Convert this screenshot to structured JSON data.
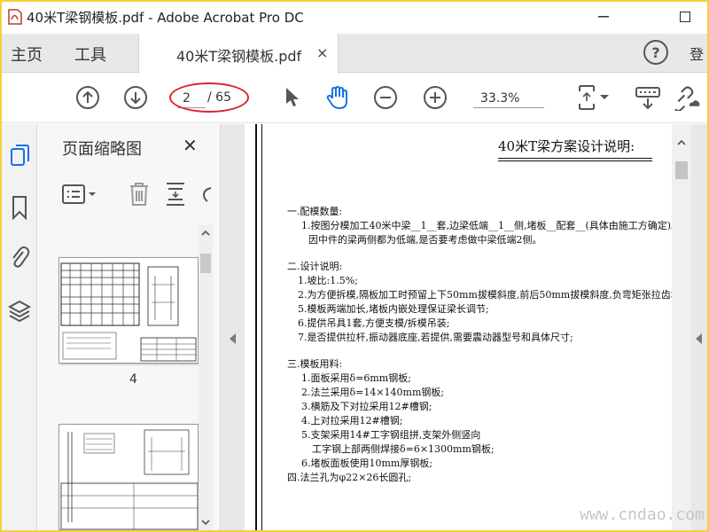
{
  "window": {
    "title": "40米T梁钢模板.pdf - Adobe Acrobat Pro DC"
  },
  "menubar": {
    "home": "主页",
    "tools": "工具",
    "tab_label": "40米T梁钢模板.pdf",
    "tab_close": "×",
    "help": "?",
    "sign_in": "登"
  },
  "toolbar": {
    "current_page": "2",
    "total_pages": "/ 65",
    "zoom": "33.3%"
  },
  "thumb_panel": {
    "title": "页面缩略图",
    "close": "✕",
    "page_label": "4"
  },
  "document": {
    "title": "40米T梁方案设计说明:",
    "lines": [
      "一.配模数量:",
      "1.按图分模加工40米中梁__1__套,边梁低端__1__侧,堵板__配套__(具体由施工方确定)。",
      "因中件的梁两侧都为低端,是否要考虑做中梁低端2侧。",
      "二.设计说明:",
      "1.坡比:1.5%;",
      "2.为方便拆模,隔板加工时预留上下50mm拔模斜度,前后50mm拔模斜度,负弯矩张拉齿块预",
      "5.模板两端加长,堵板内嵌处理保证梁长调节;",
      "6.提供吊具1套,方便支模/拆模吊装;",
      "7.是否提供拉杆,振动器底座,若提供,需要震动器型号和具体尺寸;",
      "三.模板用料:",
      "1.面板采用δ=6mm钢板;",
      "2.法兰采用δ=14×140mm钢板;",
      "3.横筋及下对拉采用12#槽钢;",
      "4.上对拉采用12#槽钢;",
      "5.支架采用14#工字钢组拼,支架外侧竖向",
      "工字钢上部两侧焊接δ=6×1300mm钢板;",
      "6.堵板面板使用10mm厚钢板;",
      "四.法兰孔为φ22×26长圆孔;"
    ]
  },
  "watermark": "www.cndao.com",
  "colors": {
    "accent_blue": "#1473e6",
    "highlight_red": "#d9262b",
    "frame_yellow": "#f4d03f"
  }
}
